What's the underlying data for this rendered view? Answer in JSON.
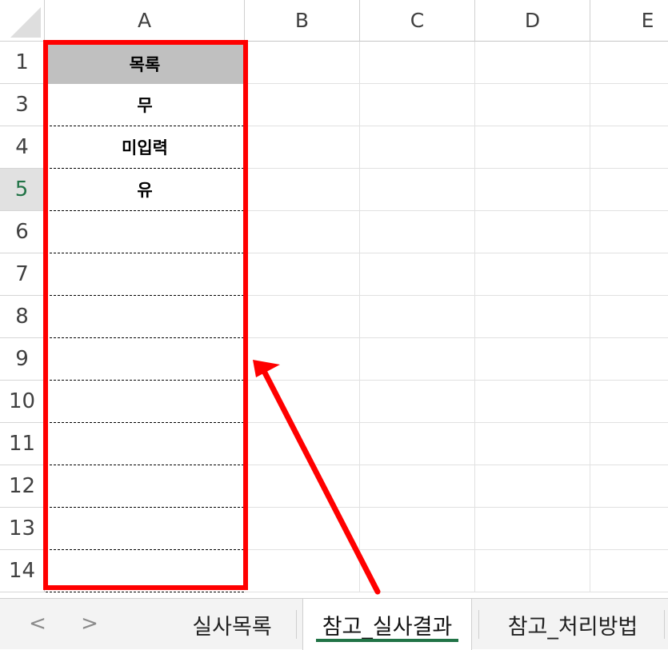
{
  "columns": [
    "A",
    "B",
    "C",
    "D",
    "E"
  ],
  "rows": [
    {
      "num": "1",
      "value": "목록",
      "header": true,
      "active": false
    },
    {
      "num": "3",
      "value": "무",
      "header": false,
      "active": false
    },
    {
      "num": "4",
      "value": "미입력",
      "header": false,
      "active": false
    },
    {
      "num": "5",
      "value": "유",
      "header": false,
      "active": true
    },
    {
      "num": "6",
      "value": "",
      "header": false,
      "active": false
    },
    {
      "num": "7",
      "value": "",
      "header": false,
      "active": false
    },
    {
      "num": "8",
      "value": "",
      "header": false,
      "active": false
    },
    {
      "num": "9",
      "value": "",
      "header": false,
      "active": false
    },
    {
      "num": "10",
      "value": "",
      "header": false,
      "active": false
    },
    {
      "num": "11",
      "value": "",
      "header": false,
      "active": false
    },
    {
      "num": "12",
      "value": "",
      "header": false,
      "active": false
    },
    {
      "num": "13",
      "value": "",
      "header": false,
      "active": false
    },
    {
      "num": "14",
      "value": "",
      "header": false,
      "active": false
    }
  ],
  "tabbar": {
    "prev_icon": "chevron-left-icon",
    "next_icon": "chevron-right-icon",
    "prev_glyph": "<",
    "next_glyph": ">",
    "tabs": [
      {
        "label": "실사목록",
        "active": false
      },
      {
        "label": "참고_실사결과",
        "active": true
      },
      {
        "label": "참고_처리방법",
        "active": false
      }
    ]
  },
  "colors": {
    "highlight": "#ff0000",
    "accent": "#217346",
    "header_fill": "#c0c0c0"
  }
}
